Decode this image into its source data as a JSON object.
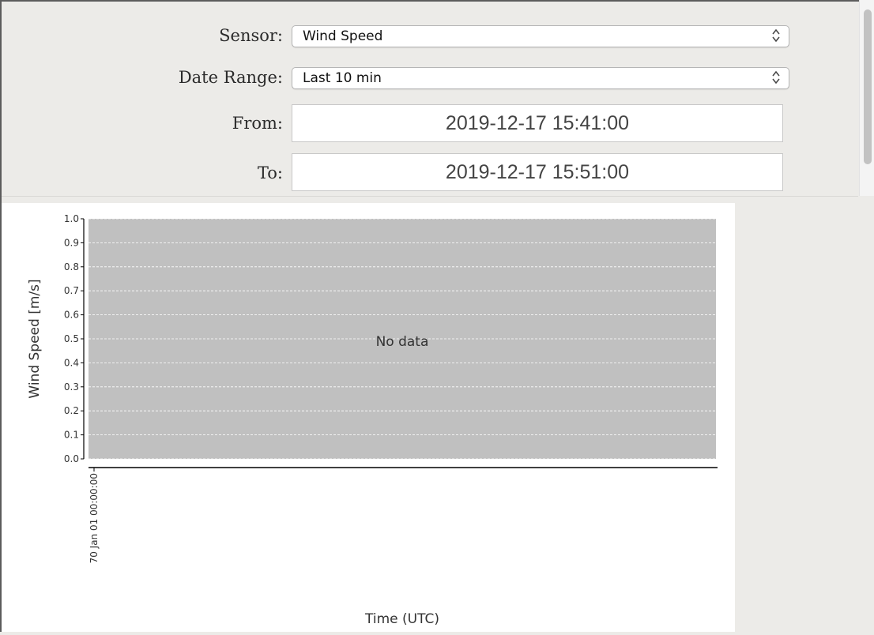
{
  "form": {
    "sensor_label": "Sensor:",
    "sensor_value": "Wind Speed",
    "date_range_label": "Date Range:",
    "date_range_value": "Last 10 min",
    "from_label": "From:",
    "from_value": "2019-12-17 15:41:00",
    "to_label": "To:",
    "to_value": "2019-12-17 15:51:00"
  },
  "icons": {
    "select_arrows": "updown-chevron-icon"
  },
  "chart_data": {
    "type": "line",
    "x": [],
    "series": [],
    "ylabel": "Wind Speed [m/s]",
    "xlabel": "Time (UTC)",
    "ylim": [
      0.0,
      1.0
    ],
    "yticks": [
      "0.0",
      "0.1",
      "0.2",
      "0.3",
      "0.4",
      "0.5",
      "0.6",
      "0.7",
      "0.8",
      "0.9",
      "1.0"
    ],
    "xticks": [
      "70 Jan 01 00:00:00"
    ],
    "message": "No data",
    "grid": true,
    "colors": {
      "plot_bg": "#c0c0c0",
      "grid": "#ffffff"
    }
  }
}
